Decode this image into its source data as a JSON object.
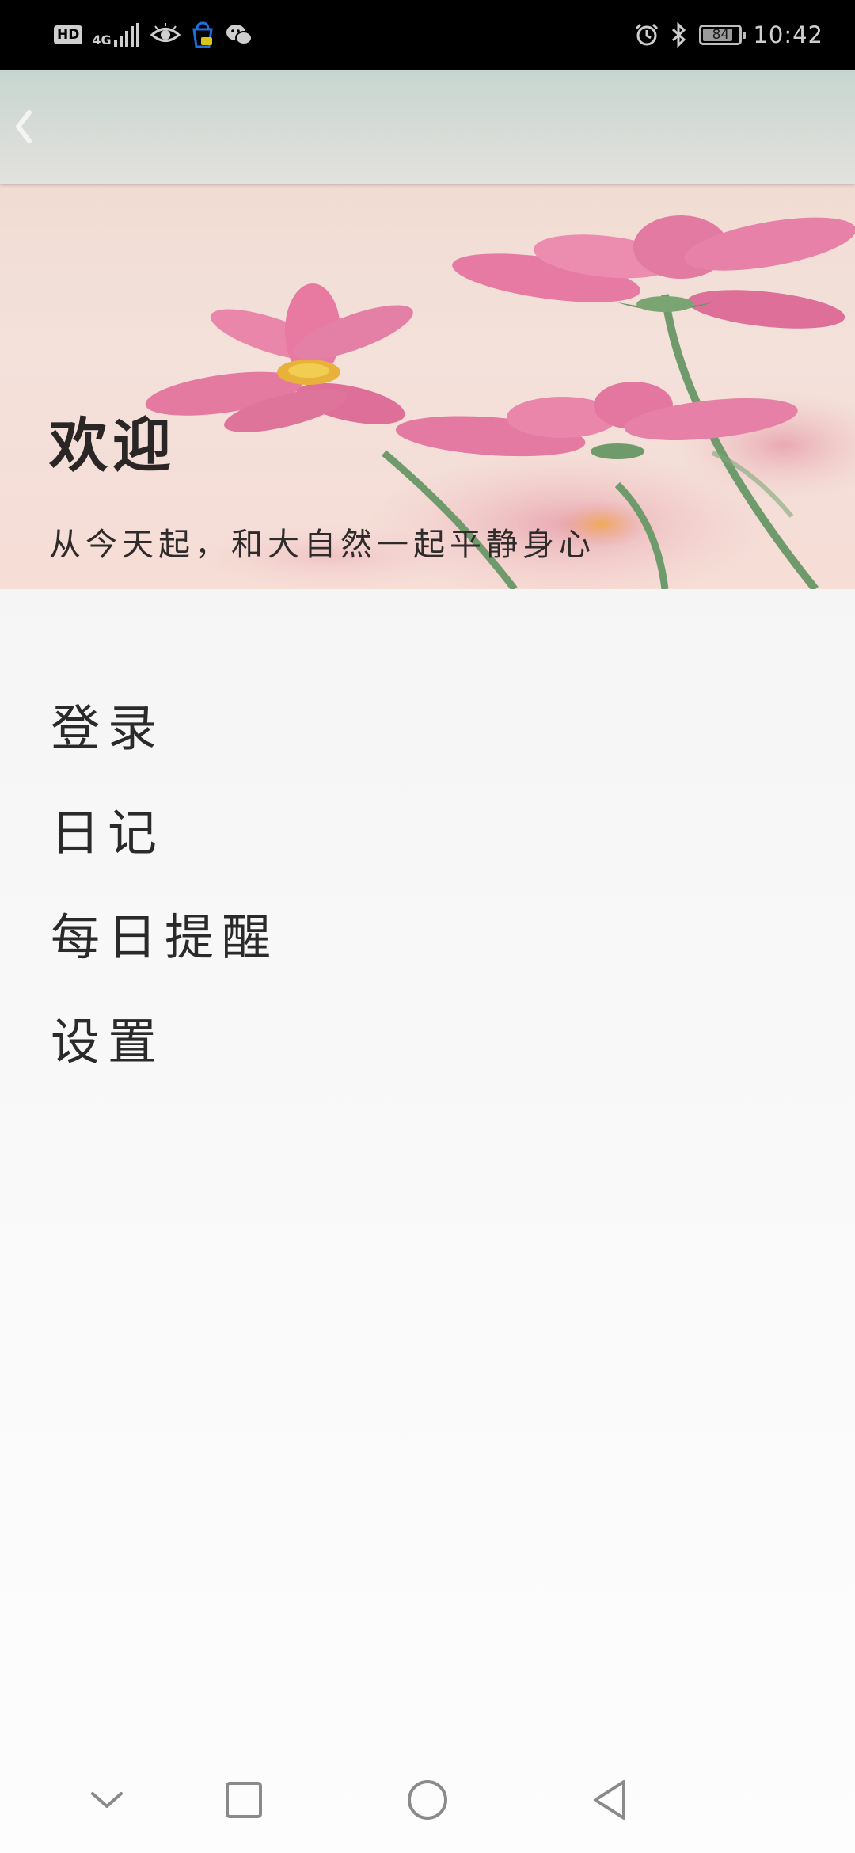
{
  "status_bar": {
    "hd_label": "HD",
    "network_label": "4G",
    "battery_level": 84,
    "battery_text": "84",
    "time": "10:42",
    "icons": [
      "hd-icon",
      "signal-4g-icon",
      "eye-icon",
      "notification-bag-icon",
      "wechat-icon",
      "alarm-icon",
      "bluetooth-icon",
      "battery-icon"
    ]
  },
  "header": {
    "back_icon": "chevron-left-icon"
  },
  "banner": {
    "title": "欢迎",
    "subtitle": "从今天起，和大自然一起平静身心"
  },
  "menu": {
    "items": [
      {
        "label": "登录"
      },
      {
        "label": "日记"
      },
      {
        "label": "每日提醒"
      },
      {
        "label": "设置"
      }
    ]
  },
  "nav_bar": {
    "icons": [
      "chevron-down-icon",
      "recents-square-icon",
      "home-circle-icon",
      "back-triangle-icon"
    ]
  },
  "colors": {
    "status_bar_bg": "#000000",
    "header_bg": "#d2dcd7",
    "banner_bg": "#f3e0d8",
    "flower_pink": "#e8739c",
    "page_bg": "#f5f5f5",
    "text": "#2a2a2a"
  }
}
